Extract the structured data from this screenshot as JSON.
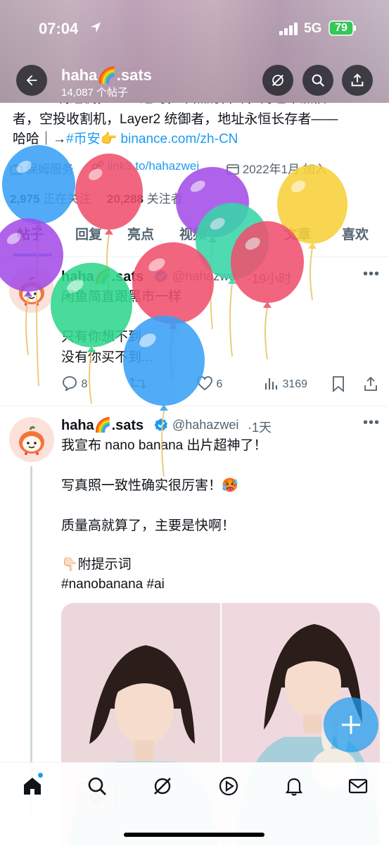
{
  "status_bar": {
    "time": "07:04",
    "network": "5G",
    "battery": "79"
  },
  "header": {
    "name": "haha🌈.sats",
    "post_count": "14,087 个帖子",
    "back_icon": "arrow-left-icon",
    "actions": [
      "grok-icon",
      "search-icon",
      "share-icon"
    ]
  },
  "bio": {
    "line_top_partial": "FOMO 制造机，SOL 进马，平照奶告珠，另包平加旧",
    "line2": "者，空投收割机，Layer2 统御者，地址永恒长存者——",
    "line3_prefix": "哈哈｜→",
    "line3_hashtag": "#币安",
    "line3_emoji": "👉",
    "line3_link": "binance.com/zh-CN"
  },
  "profile_meta": {
    "category": "保姆服务",
    "website": "link3.to/hahazwei",
    "joined": "2022年1月 加入"
  },
  "follow_stats": {
    "following_count": "2,975",
    "following_label": "正在关注",
    "followers_count": "20,288",
    "followers_label": "关注者"
  },
  "tabs": [
    "帖子",
    "回复",
    "亮点",
    "视频",
    "文章",
    "喜欢"
  ],
  "active_tab": "帖子",
  "posts": [
    {
      "name": "haha🌈.sats",
      "verified": true,
      "handle": "@hahazwei",
      "time": "·19小时",
      "lines": [
        "闲鱼简直跟黑市一样",
        "",
        "只有你想不到",
        "没有你买不到..."
      ],
      "replies": "8",
      "reposts": "",
      "likes": "6",
      "views": "3169"
    },
    {
      "name": "haha🌈.sats",
      "verified": true,
      "handle": "@hahazwei",
      "time": "·1天",
      "lines": [
        "我宣布 nano banana 出片超神了！",
        "",
        "写真照一致性确实很厉害！🥵",
        "",
        "质量高就算了，主要是快啊！",
        "",
        "👇🏻附提示词"
      ],
      "hashtags": "#nanobanana #ai"
    }
  ],
  "bottom_nav": [
    "home-icon",
    "search-icon",
    "grok-icon",
    "video-icon",
    "bell-icon",
    "mail-icon"
  ],
  "colors": {
    "accent": "#1d9bf0",
    "text_primary": "#0f1419",
    "text_secondary": "#536471",
    "verified": "#1d9bf0"
  }
}
